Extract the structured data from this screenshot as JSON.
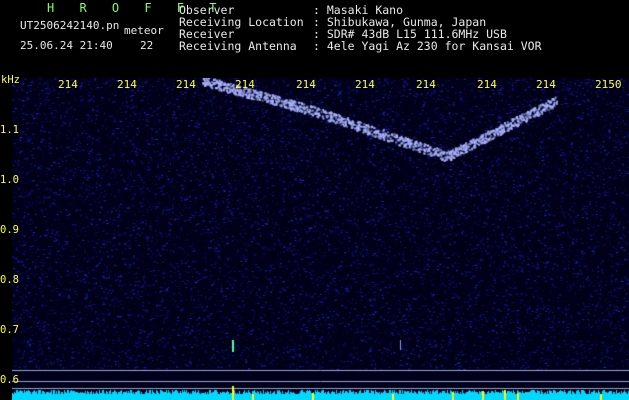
{
  "header": {
    "app_title": "H R O F F T",
    "file_name": "UT2506242140.pn",
    "mode": "meteor",
    "datetime": "25.06.24 21:40",
    "count": "22"
  },
  "info": [
    {
      "label": "Observer",
      "sep": ":",
      "value": "Masaki Kano"
    },
    {
      "label": "Receiving Location",
      "sep": ":",
      "value": "Shibukawa, Gunma, Japan"
    },
    {
      "label": "Receiver",
      "sep": ":",
      "value": "SDR# 43dB L15 111.6MHz USB"
    },
    {
      "label": "Receiving Antenna",
      "sep": ":",
      "value": "4ele Yagi Az 230 for Kansai VOR"
    }
  ],
  "spectrogram": {
    "y_unit": "kHz",
    "y_ticks": [
      "1.1",
      "1.0",
      "0.9",
      "0.8",
      "0.7",
      "0.6"
    ],
    "x_ticks": [
      "214",
      "214",
      "214",
      "214",
      "214",
      "214",
      "214",
      "214",
      "214",
      "2150"
    ],
    "colors": {
      "background": "#000018",
      "noise": "#1a3cff",
      "signal": "#aab4ff",
      "baseline": "#00d8ff",
      "burst": "#ffff00"
    }
  }
}
